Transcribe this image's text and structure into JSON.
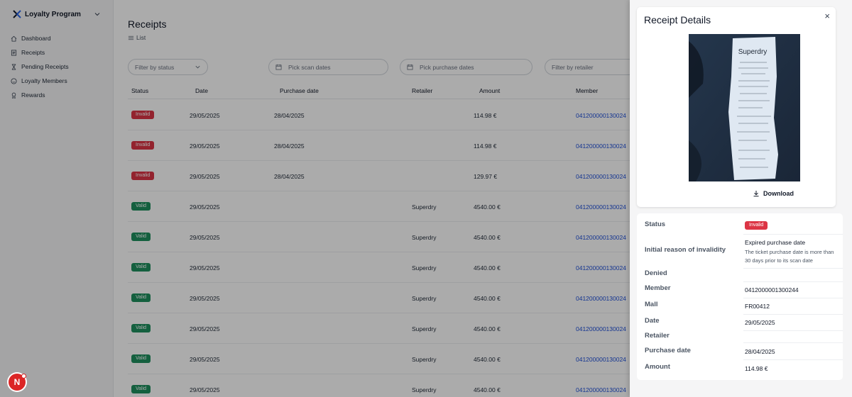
{
  "sidebar": {
    "app_title": "Loyalty Program",
    "items": [
      {
        "label": "Dashboard",
        "icon": "home-icon"
      },
      {
        "label": "Receipts",
        "icon": "receipt-icon"
      },
      {
        "label": "Pending Receipts",
        "icon": "hourglass-icon"
      },
      {
        "label": "Loyalty Members",
        "icon": "smile-icon"
      },
      {
        "label": "Rewards",
        "icon": "award-icon"
      }
    ]
  },
  "main": {
    "title": "Receipts",
    "view_mode": "List",
    "filters": {
      "status_placeholder": "Filter by status",
      "scan_dates_placeholder": "Pick scan dates",
      "purchase_dates_placeholder": "Pick purchase dates",
      "retailer_placeholder": "Filter by retailer"
    },
    "table": {
      "headers": {
        "status": "Status",
        "date": "Date",
        "purchase_date": "Purchase date",
        "retailer": "Retailer",
        "amount": "Amount",
        "member": "Member"
      },
      "rows": [
        {
          "status": "Invalid",
          "date": "29/05/2025",
          "purchase_date": "28/04/2025",
          "retailer": "",
          "amount": "114.98 €",
          "member": "041200000130024"
        },
        {
          "status": "Invalid",
          "date": "29/05/2025",
          "purchase_date": "28/04/2025",
          "retailer": "",
          "amount": "114.98 €",
          "member": "041200000130024"
        },
        {
          "status": "Invalid",
          "date": "29/05/2025",
          "purchase_date": "28/04/2025",
          "retailer": "",
          "amount": "129.97 €",
          "member": "041200000130024"
        },
        {
          "status": "Valid",
          "date": "29/05/2025",
          "purchase_date": "",
          "retailer": "Superdry",
          "amount": "4540.00 €",
          "member": "041200000130024"
        },
        {
          "status": "Valid",
          "date": "29/05/2025",
          "purchase_date": "",
          "retailer": "Superdry",
          "amount": "4540.00 €",
          "member": "041200000130024"
        },
        {
          "status": "Valid",
          "date": "29/05/2025",
          "purchase_date": "",
          "retailer": "Superdry",
          "amount": "4540.00 €",
          "member": "041200000130024"
        },
        {
          "status": "Valid",
          "date": "29/05/2025",
          "purchase_date": "",
          "retailer": "Superdry",
          "amount": "4540.00 €",
          "member": "041200000130024"
        },
        {
          "status": "Valid",
          "date": "29/05/2025",
          "purchase_date": "",
          "retailer": "Superdry",
          "amount": "4540.00 €",
          "member": "041200000130024"
        },
        {
          "status": "Valid",
          "date": "29/05/2025",
          "purchase_date": "",
          "retailer": "Superdry",
          "amount": "4540.00 €",
          "member": "041200000130024"
        },
        {
          "status": "Valid",
          "date": "29/05/2025",
          "purchase_date": "",
          "retailer": "Superdry",
          "amount": "4540.00 €",
          "member": "041200000130024"
        }
      ]
    }
  },
  "drawer": {
    "title": "Receipt Details",
    "close_symbol": "×",
    "download_label": "Download",
    "receipt_brand": "Superdry",
    "details": {
      "status_label": "Status",
      "status_value": "Invalid",
      "reason_label": "Initial reason of invalidity",
      "reason_title": "Expired purchase date",
      "reason_desc_line1": "The ticket purchase date is more than",
      "reason_desc_line2": "30 days prior to its scan date",
      "denied_label": "Denied",
      "member_label": "Member",
      "member_value": "0412000001300244",
      "mall_label": "Mall",
      "mall_value": "FR00412",
      "date_label": "Date",
      "date_value": "29/05/2025",
      "retailer_label": "Retailer",
      "purchase_date_label": "Purchase date",
      "purchase_date_value": "28/04/2025",
      "amount_label": "Amount",
      "amount_value": "114.98 €"
    }
  },
  "user": {
    "avatar_initial": "N"
  },
  "colors": {
    "invalid": "#dc3545",
    "valid": "#1f8f5f",
    "link": "#1d4ed8",
    "avatar": "#dc2626"
  }
}
